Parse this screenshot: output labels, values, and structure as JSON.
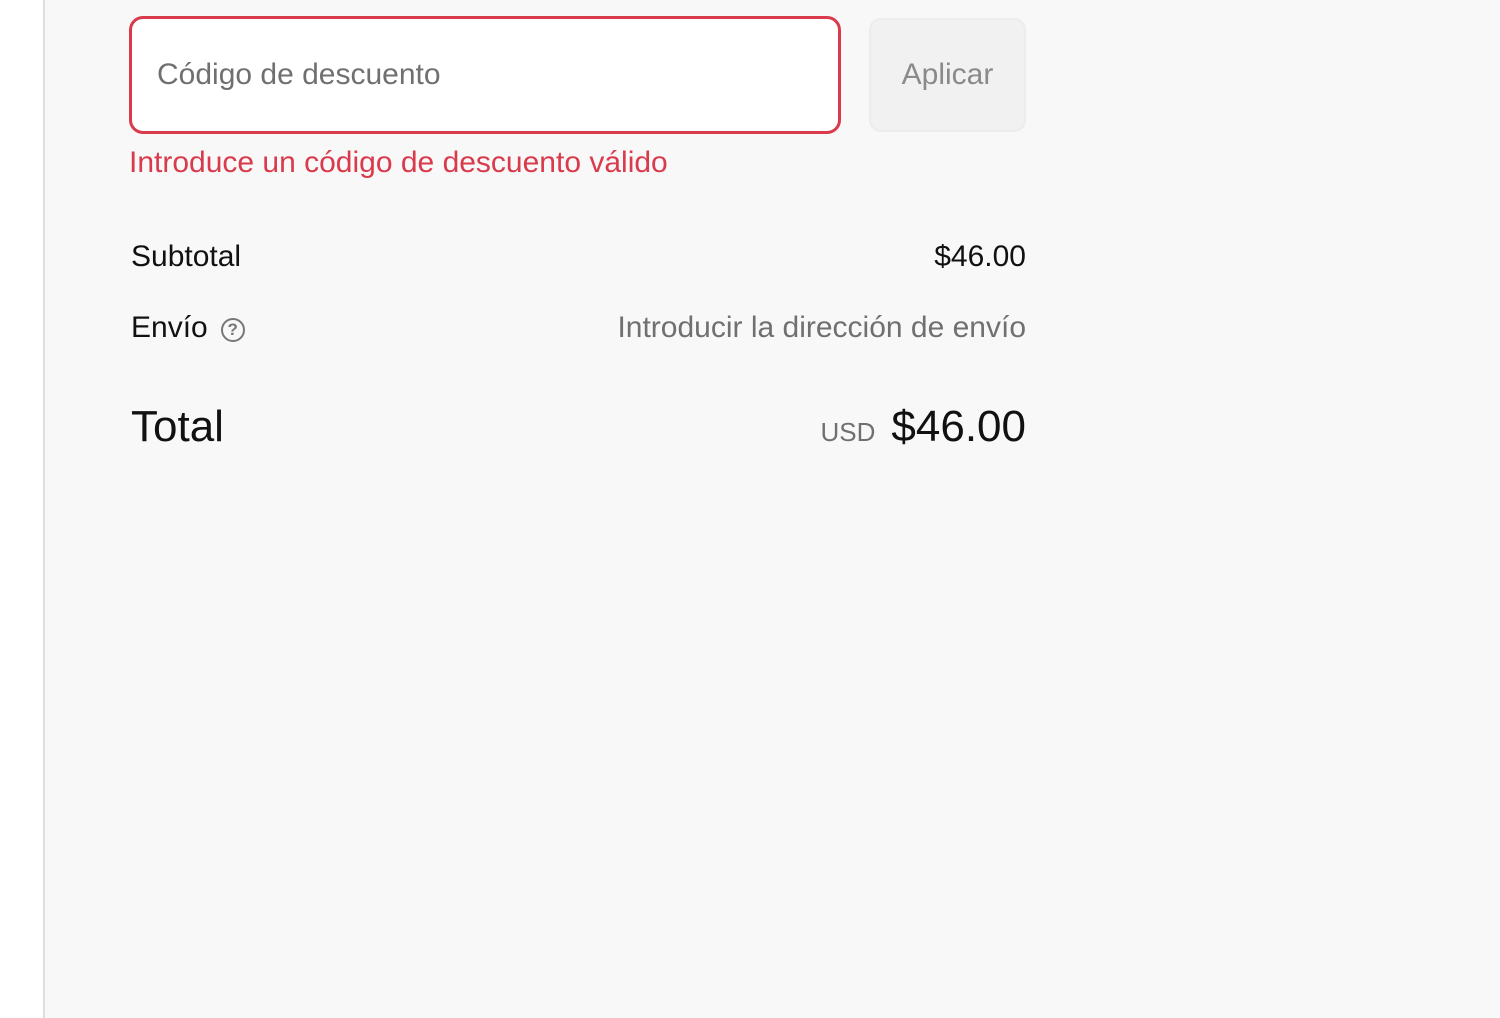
{
  "discount": {
    "placeholder": "Código de descuento",
    "value": "",
    "apply_label": "Aplicar",
    "error_message": "Introduce un código de descuento válido",
    "error_color": "#d93a4c"
  },
  "summary": {
    "subtotal_label": "Subtotal",
    "subtotal_value": "$46.00",
    "shipping_label": "Envío",
    "shipping_help_icon": "question-circle-icon",
    "shipping_value": "Introducir la dirección de envío",
    "total_label": "Total",
    "currency_code": "USD",
    "total_value": "$46.00"
  }
}
